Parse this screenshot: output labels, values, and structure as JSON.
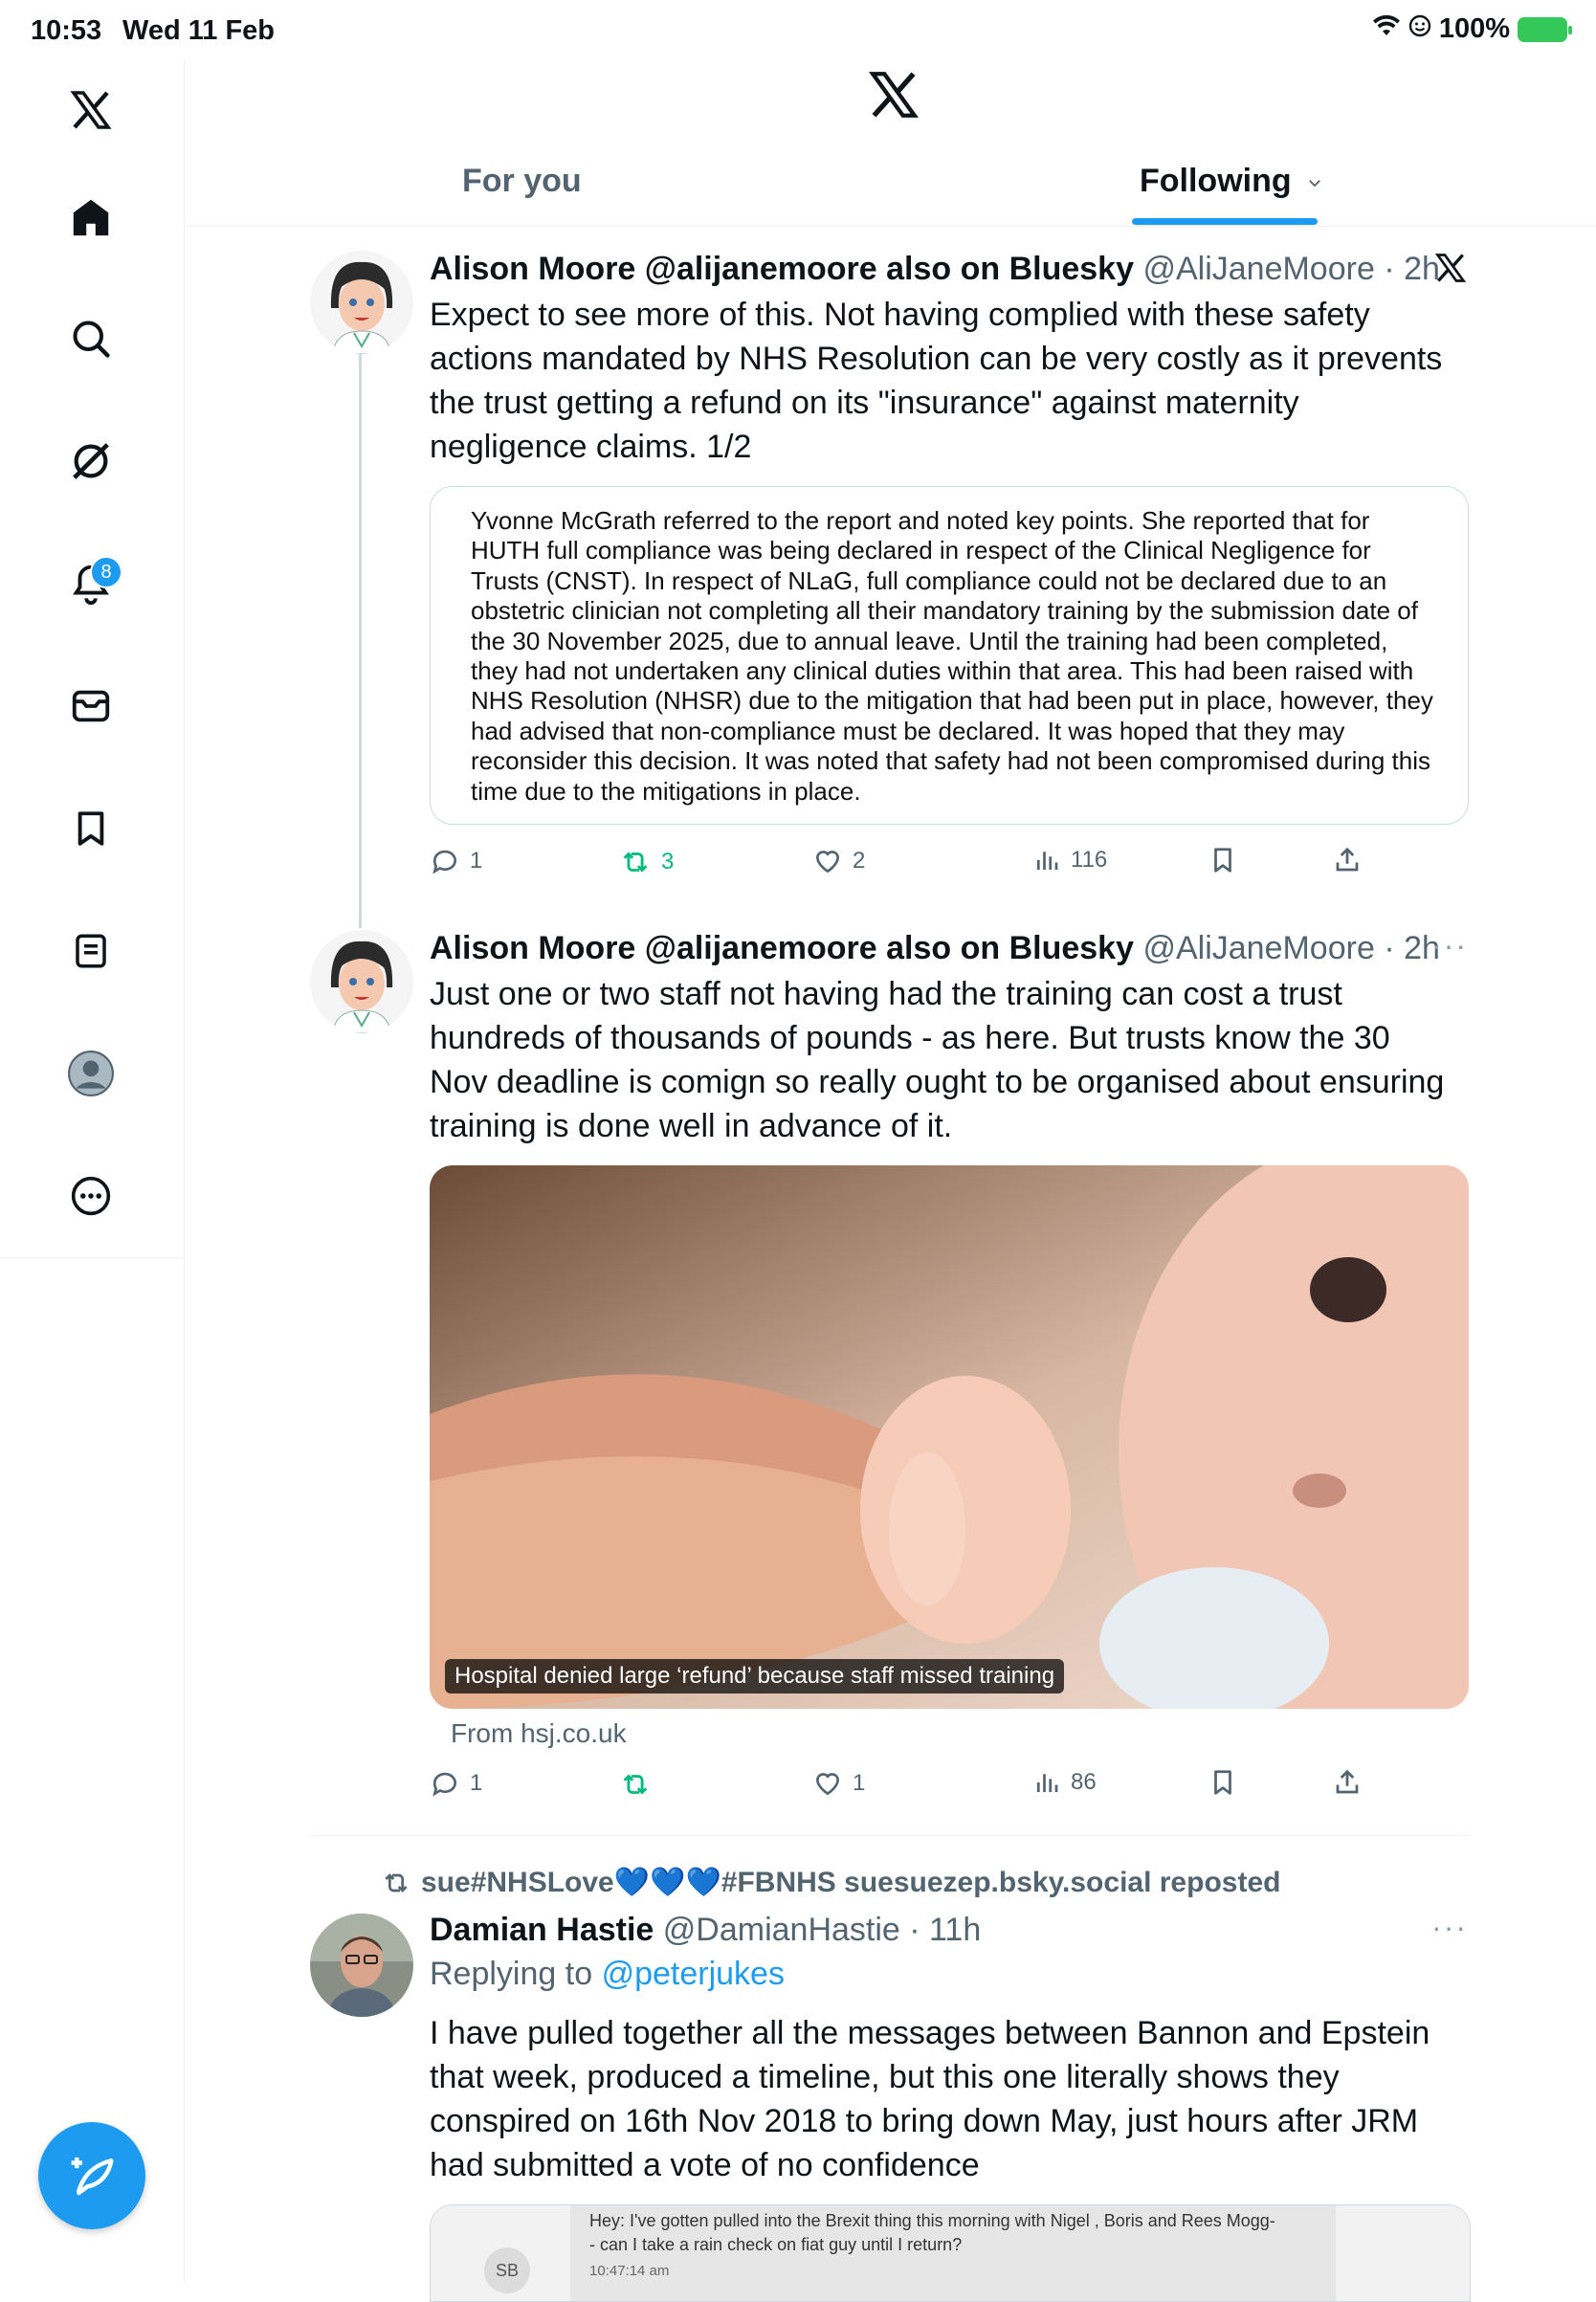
{
  "status_bar": {
    "time": "10:53",
    "date": "Wed 11 Feb",
    "battery": "100%"
  },
  "sidebar": {
    "notifications_badge": "8"
  },
  "header": {
    "tabs": [
      {
        "label": "For you"
      },
      {
        "label": "Following"
      }
    ]
  },
  "tweets": [
    {
      "name": "Alison Moore @alijanemoore also on Bluesky",
      "handle": "@AliJaneMoore",
      "time": "· 2h",
      "text": "Expect to see more of this. Not having complied with these safety actions mandated by NHS Resolution can be very costly as it prevents the trust getting a refund on its \"insurance\" against maternity negligence claims. 1/2",
      "quote_image_text": "Yvonne McGrath referred to the report and noted key points. She reported that for HUTH full compliance was being declared in respect of the Clinical Negligence for Trusts (CNST). In respect of NLaG, full compliance could not be declared due to an obstetric clinician not completing all their mandatory training by the submission date of the 30 November 2025, due to annual leave. Until the training had been completed, they had not undertaken any clinical duties within that area. This had been raised with NHS Resolution (NHSR) due to the mitigation that had been put in place, however, they had advised that non-compliance must be declared. It was hoped that they may reconsider this decision. It was noted that safety had not been compromised during this time due to the mitigations in place.",
      "replies": "1",
      "reposts": "3",
      "likes": "2",
      "views": "116"
    },
    {
      "name": "Alison Moore @alijanemoore also on Bluesky",
      "handle": "@AliJaneMoore",
      "time": "· 2h",
      "text": "Just one or two staff not having had the training can cost a trust hundreds of thousands of pounds - as here. But trusts know the 30 Nov deadline is comign so really ought to be organised about ensuring training is done well in advance of it.",
      "card_caption": "Hospital denied large ‘refund’ because staff missed training",
      "card_source": "From hsj.co.uk",
      "replies": "1",
      "reposts": "",
      "likes": "1",
      "views": "86"
    },
    {
      "reposted_by": "sue#NHSLove💙💙💙#FBNHS suesuezep.bsky.social reposted",
      "name": "Damian Hastie",
      "handle": "@DamianHastie",
      "time": "· 11h",
      "replying_prefix": "Replying to",
      "replying_to": "@peterjukes",
      "text": "I have pulled together all the messages between Bannon and Epstein that week, produced a timeline, but this one literally shows they conspired on 16th Nov 2018 to bring down May, just hours after JRM had submitted a vote of no confidence",
      "image_msg_initials": "SB",
      "image_msg_text": "Hey: I've gotten pulled into the Brexit thing this morning with Nigel , Boris and Rees Mogg-- can  I take a rain check on fiat guy until I return?",
      "image_msg_time": "10:47:14 am"
    }
  ],
  "colors": {
    "accent": "#1d9bf0",
    "repost_green": "#00ba7c",
    "secondary_text": "#536471"
  }
}
